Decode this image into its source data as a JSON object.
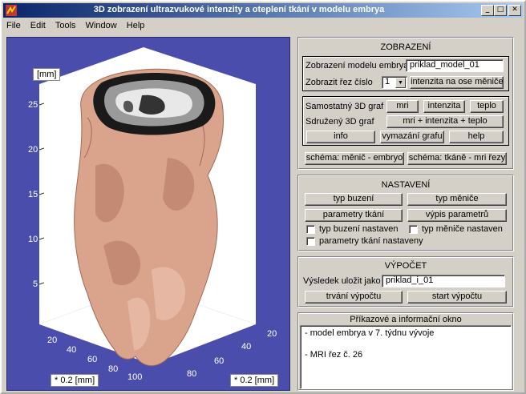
{
  "window": {
    "title": "3D zobrazení ultrazvukové intenzity a oteplení tkání v modelu embrya",
    "buttons": {
      "minimize": "_",
      "maximize": "□",
      "close": "✕"
    }
  },
  "menu": {
    "file": "File",
    "edit": "Edit",
    "tools": "Tools",
    "window": "Window",
    "help": "Help"
  },
  "plot": {
    "zlabel": "[mm]",
    "xlabel": "* 0.2 [mm]",
    "ylabel": "* 0.2 [mm]",
    "zticks": [
      "25",
      "20",
      "15",
      "10",
      "5"
    ],
    "xticks": [
      "20",
      "40",
      "60",
      "80",
      "100"
    ],
    "yticks": [
      "20",
      "40",
      "60",
      "80"
    ],
    "colors": {
      "background": "#4b4dad",
      "surface": "#d9a38c",
      "box": "#ffffff"
    }
  },
  "zobrazeni": {
    "title": "ZOBRAZENÍ",
    "model_label": "Zobrazení modelu embrya",
    "model_value": "priklad_model_01",
    "rez_label": "Zobrazit řez číslo",
    "rez_value": "1",
    "intenzita_osa_button": "intenzita na ose měniče",
    "samostatny_label": "Samostatný 3D graf",
    "mri_button": "mri",
    "intenzita_button": "intenzita",
    "teplo_button": "teplo",
    "sdruzeny_label": "Sdružený 3D graf",
    "sdruzeny_button": "mri  +  intenzita  +  teplo",
    "info_button": "info",
    "vymazani_button": "vymazání grafu",
    "help_button": "help",
    "schema1_button": "schéma: měnič - embryo",
    "schema2_button": "schéma: tkáně - mri řezy"
  },
  "nastaveni": {
    "title": "NASTAVENÍ",
    "typ_buzeni_button": "typ buzení",
    "typ_menice_button": "typ měniče",
    "parametry_button": "parametry tkání",
    "vypis_button": "výpis parametrů",
    "chk_buzeni": "typ buzení nastaven",
    "chk_menice": "typ měniče nastaven",
    "chk_parametry": "parametry tkání nastaveny"
  },
  "vypocet": {
    "title": "VÝPOČET",
    "ulozit_label": "Výsledek uložit jako",
    "ulozit_value": "priklad_i_01",
    "trvani_button": "trvání výpočtu",
    "start_button": "start výpočtu"
  },
  "info_okno": {
    "title": "Příkazové a informační okno",
    "lines": [
      "- model embrya v 7. týdnu vývoje",
      "- MRI řez č. 26"
    ]
  }
}
